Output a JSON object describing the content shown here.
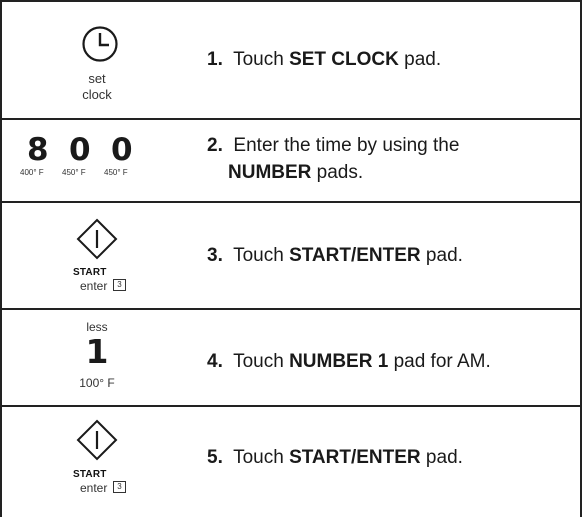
{
  "rows": [
    {
      "caption_line1": "set",
      "caption_line2": "clock",
      "step_number": "1.",
      "text_pre": "Touch ",
      "text_bold": "SET CLOCK",
      "text_post": " pad."
    },
    {
      "digits": [
        "8",
        "0",
        "0"
      ],
      "temps": [
        "400° F",
        "450° F",
        "450° F"
      ],
      "step_number": "2.",
      "text_pre": "Enter the time by using the",
      "text_bold": "NUMBER",
      "text_post": " pads."
    },
    {
      "start_label": "START",
      "enter_label": "enter",
      "box_digit": "3",
      "step_number": "3.",
      "text_pre": "Touch ",
      "text_bold": "START/ENTER",
      "text_post": " pad."
    },
    {
      "top_label": "less",
      "digit": "1",
      "temp": "100° F",
      "step_number": "4.",
      "text_pre": "Touch ",
      "text_bold": "NUMBER 1",
      "text_post": " pad for AM."
    },
    {
      "start_label": "START",
      "enter_label": "enter",
      "box_digit": "3",
      "step_number": "5.",
      "text_pre": "Touch ",
      "text_bold": "START/ENTER",
      "text_post": " pad."
    }
  ],
  "icons": [
    "clock-icon",
    "start-diamond-icon",
    "start-diamond-icon"
  ]
}
